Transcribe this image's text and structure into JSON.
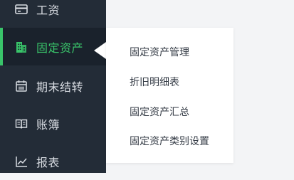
{
  "sidebar": {
    "items": [
      {
        "label": "工资",
        "icon": "wallet-card-icon",
        "active": false
      },
      {
        "label": "固定资产",
        "icon": "building-icon",
        "active": true
      },
      {
        "label": "期末结转",
        "icon": "calendar-icon",
        "active": false
      },
      {
        "label": "账簿",
        "icon": "open-book-icon",
        "active": false
      },
      {
        "label": "报表",
        "icon": "line-chart-icon",
        "active": false
      }
    ]
  },
  "submenu": {
    "items": [
      {
        "label": "固定资产管理"
      },
      {
        "label": "折旧明细表"
      },
      {
        "label": "固定资产汇总"
      },
      {
        "label": "固定资产类别设置"
      }
    ]
  },
  "colors": {
    "sidebar_bg": "#232c37",
    "active_bg": "#1a222c",
    "accent": "#39c46a",
    "nav_text": "#d8dce2",
    "submenu_bg": "#ffffff",
    "submenu_text": "#333a44",
    "page_bg": "#f3f4f6"
  }
}
